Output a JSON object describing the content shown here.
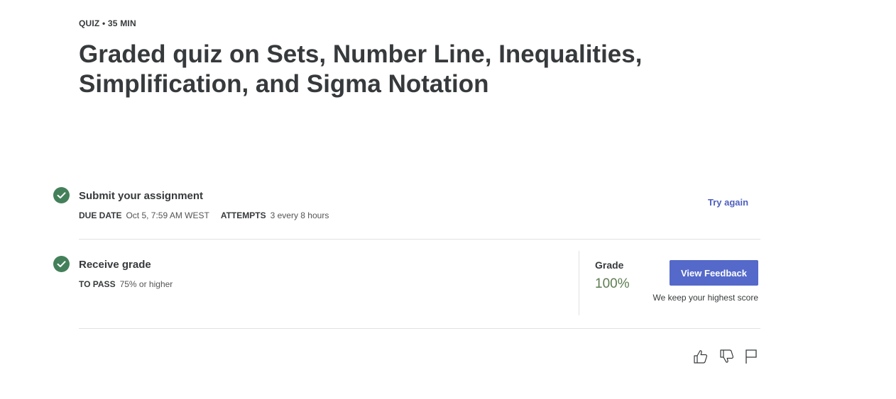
{
  "header": {
    "meta": "QUIZ • 35 MIN",
    "title": "Graded quiz on Sets, Number Line, Inequalities, Simplification, and Sigma Notation"
  },
  "submit": {
    "title": "Submit your assignment",
    "due_label": "DUE DATE",
    "due_value": "Oct 5, 7:59 AM WEST",
    "attempts_label": "ATTEMPTS",
    "attempts_value": "3 every 8 hours",
    "try_again": "Try again"
  },
  "receive": {
    "title": "Receive grade",
    "pass_label": "TO PASS",
    "pass_value": "75% or higher"
  },
  "grade": {
    "label": "Grade",
    "value": "100%",
    "feedback_button": "View Feedback",
    "note": "We keep your highest score"
  },
  "icons": {
    "like": "thumbs-up-icon",
    "dislike": "thumbs-down-icon",
    "flag": "flag-icon",
    "check": "check-circle-icon"
  },
  "colors": {
    "check_green": "#43805a",
    "link_blue": "#4e5fbf",
    "button_blue": "#5469c9",
    "grade_green": "#5e7d52"
  }
}
